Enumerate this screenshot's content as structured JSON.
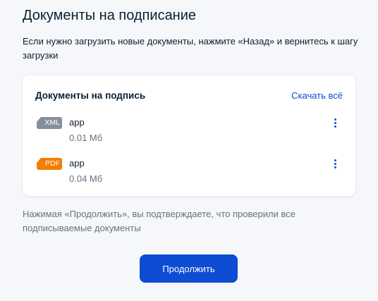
{
  "page": {
    "title": "Документы на подписание",
    "intro": "Если нужно загрузить новые документы, нажмите «Назад» и вернитесь к шагу загрузки"
  },
  "documents": {
    "title": "Документы на подпись",
    "download_all": "Скачать всё",
    "files": [
      {
        "type": "XML",
        "name": "app",
        "size": "0.01 Мб",
        "icon": "xml-file-icon",
        "color": "#86909c"
      },
      {
        "type": "PDF",
        "name": "app",
        "size": "0.04 Мб",
        "icon": "pdf-file-icon",
        "color": "#f07e00"
      }
    ],
    "more_icon": "more-vertical-icon"
  },
  "footer": {
    "confirm_text": "Нажимая «Продолжить», вы подтверждаете, что проверили все подписываемые документы",
    "continue_label": "Продолжить"
  },
  "colors": {
    "accent": "#0d4cd3",
    "background": "#f5f7fa",
    "text": "#0b1f33",
    "secondary_text": "#66727f"
  }
}
